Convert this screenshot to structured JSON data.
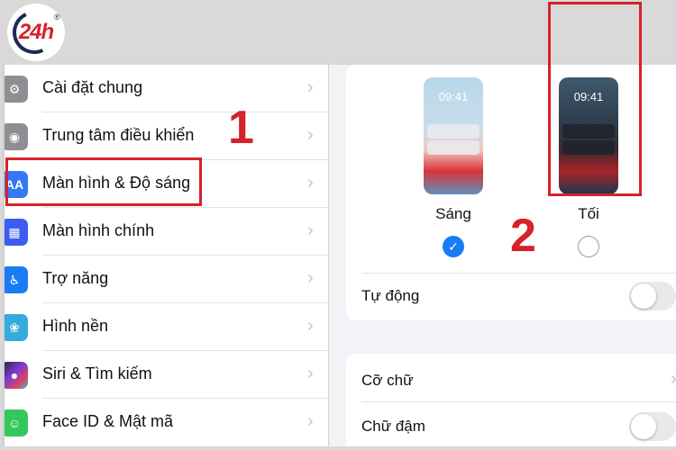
{
  "logo": {
    "text": "24h",
    "registered": "®"
  },
  "settings_list": {
    "items": [
      {
        "label": "Cài đặt chung",
        "icon": "gear-icon",
        "glyph": "⚙"
      },
      {
        "label": "Trung tâm điều khiển",
        "icon": "toggles-icon",
        "glyph": "◉"
      },
      {
        "label": "Màn hình & Độ sáng",
        "icon": "text-size-icon",
        "glyph": "AA"
      },
      {
        "label": "Màn hình chính",
        "icon": "app-grid-icon",
        "glyph": "▦"
      },
      {
        "label": "Trợ năng",
        "icon": "accessibility-icon",
        "glyph": "♿"
      },
      {
        "label": "Hình nền",
        "icon": "flower-icon",
        "glyph": "❀"
      },
      {
        "label": "Siri & Tìm kiếm",
        "icon": "siri-icon",
        "glyph": "●"
      },
      {
        "label": "Face ID & Mật mã",
        "icon": "face-id-icon",
        "glyph": "☺"
      }
    ],
    "chevron": "›"
  },
  "appearance": {
    "light": {
      "label": "Sáng",
      "time": "09:41",
      "selected": true
    },
    "dark": {
      "label": "Tối",
      "time": "09:41",
      "selected": false
    },
    "check_glyph": "✓",
    "auto_label": "Tự động",
    "auto_on": false
  },
  "text_settings": {
    "font_size_label": "Cỡ chữ",
    "bold_label": "Chữ đậm",
    "bold_on": false
  },
  "annotations": {
    "step1": "1",
    "step2": "2"
  },
  "colors": {
    "annotation_red": "#d6222a",
    "ios_blue": "#1a7cf5"
  }
}
